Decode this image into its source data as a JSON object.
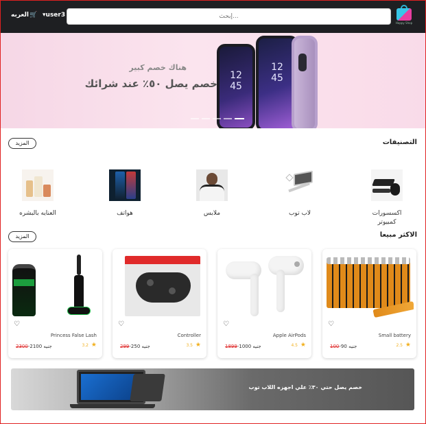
{
  "header": {
    "logo_text": "Happy Shop",
    "search_placeholder": "إبحث...",
    "user_label": "user3",
    "user_caret": "▾",
    "cart_label": "العربه",
    "cart_icon": "cart-icon"
  },
  "hero": {
    "subtitle": "هناك خصم كبير",
    "title": "خصم يصل ٥٠٪ عند شرائك",
    "phone_time": [
      "12",
      "45"
    ]
  },
  "categories": {
    "title": "التصنيفات",
    "more_label": "المزيد",
    "items": [
      {
        "label": "اكسسورات كمبيوتر"
      },
      {
        "label": "لاب توب"
      },
      {
        "label": "ملابس"
      },
      {
        "label": "هواتف"
      },
      {
        "label": "العنايه بالبشره"
      }
    ]
  },
  "best_sellers": {
    "title": "الاكثر مبيعا",
    "more_label": "المزيد",
    "products": [
      {
        "name": "Small battery",
        "rating": "2.5",
        "price": "90",
        "old_price": "100",
        "currency": "جنيه"
      },
      {
        "name": "Apple AirPods",
        "rating": "4.5",
        "price": "1000",
        "old_price": "1899",
        "currency": "جنيه"
      },
      {
        "name": "Controller",
        "rating": "3.5",
        "price": "250",
        "old_price": "299",
        "currency": "جنيه"
      },
      {
        "name": "Princess False Lash",
        "rating": "3.2",
        "price": "2100",
        "old_price": "2300",
        "currency": "جنيه"
      }
    ]
  },
  "promo_banner": {
    "text": "خصم يصل حتي ٣٠٪ علي اجهزه اللاب توب"
  },
  "colors": {
    "nav_bg": "#1e1f22",
    "star": "#f2b01e",
    "old_price": "#e03030"
  }
}
